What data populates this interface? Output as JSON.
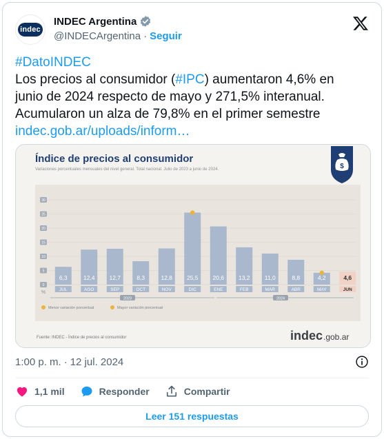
{
  "account": {
    "avatar_text": "indec",
    "display_name": "INDEC Argentina",
    "handle": "@INDECArgentina",
    "separator": "·",
    "follow_label": "Seguir"
  },
  "tweet": {
    "hashtag": "#DatoINDEC",
    "line2_a": "Los precios al consumidor (",
    "line2_tag": "#IPC",
    "line2_b": ") aumentaron 4,6% en",
    "line3": "junio de 2024 respecto de mayo y 271,5% interanual.",
    "line4": "Acumularon un alza de 79,8% en el primer semestre",
    "link": "indec.gob.ar/uploads/inform…"
  },
  "infographic": {
    "title": "Índice de precios al consumidor",
    "subtitle": "Variaciones porcentuales mensuales del nivel general. Total nacional. Julio de 2023 a junio de 2024.",
    "year_2023": "2023",
    "year_2024": "2024",
    "legend_min": "Menor variación porcentual",
    "legend_max": "Mayor variación porcentual",
    "source": "Fuente: INDEC - Índice de precios al consumidor",
    "brand_main": "indec",
    "brand_suffix": ".gob.ar",
    "colors": {
      "bar": "#a9b8cc",
      "bar_highlight": "#f1d2c4",
      "bg": "#ece8e1",
      "dot": "#e8b43c",
      "title": "#1f3f74"
    }
  },
  "chart_data": {
    "type": "bar",
    "categories": [
      "JUL",
      "AGO",
      "SEP",
      "OCT",
      "NOV",
      "DIC",
      "ENE",
      "FEB",
      "MAR",
      "ABR",
      "MAY",
      "JUN"
    ],
    "values": [
      6.3,
      12.4,
      12.7,
      8.3,
      12.8,
      25.5,
      20.6,
      13.2,
      11.0,
      8.8,
      4.2,
      4.6
    ],
    "value_labels": [
      "6,3",
      "12,4",
      "12,7",
      "8,3",
      "12,8",
      "25,5",
      "20,6",
      "13,2",
      "11,0",
      "8,8",
      "4,2",
      "4,6"
    ],
    "title": "Índice de precios al consumidor",
    "ylabel": "%",
    "yticks": [
      "0",
      "5",
      "10",
      "15",
      "20",
      "25",
      "30"
    ],
    "ylim": [
      0,
      30
    ],
    "grid": true,
    "max_marker_index": 5,
    "min_marker_index": 10,
    "highlight_index": 11
  },
  "meta": {
    "time": "1:00 p. m.",
    "separator": "·",
    "date": "12 jul. 2024"
  },
  "actions": {
    "likes": "1,1 mil",
    "reply_label": "Responder",
    "share_label": "Compartir",
    "like_color": "#f91880",
    "reply_color": "#1d9bf0"
  },
  "replies_button": "Leer 151 respuestas"
}
